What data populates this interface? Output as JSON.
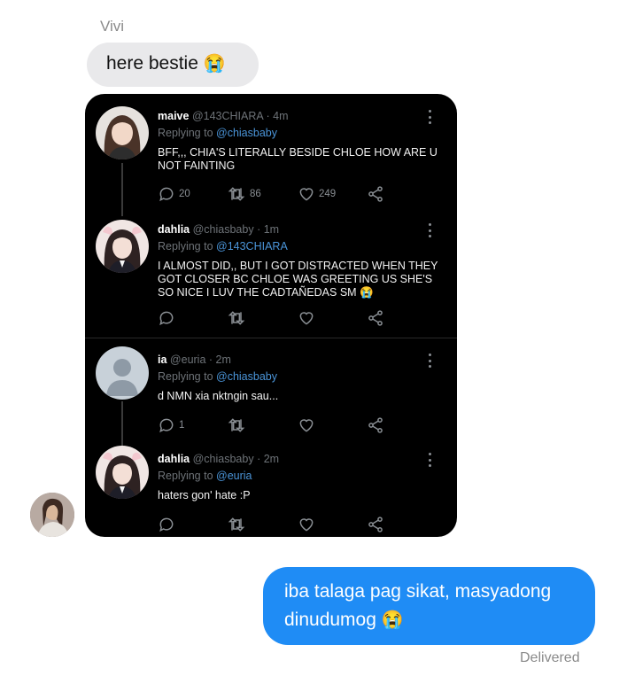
{
  "chat": {
    "sender_name": "Vivi",
    "incoming_message": "here bestie",
    "incoming_emoji": "😭",
    "outgoing_message_line1": "iba talaga pag sikat, masyadong",
    "outgoing_message_line2": "dinudumog",
    "outgoing_emoji": "😭",
    "status": "Delivered"
  },
  "tweets": [
    {
      "name": "maive",
      "handle": "@143CHIARA",
      "time": "· 4m",
      "replying_prefix": "Replying to ",
      "replying_to": "@chiasbaby",
      "body": "BFF,,, CHIA'S LITERALLY BESIDE CHLOE HOW ARE U NOT FAINTING",
      "replies": "20",
      "retweets": "86",
      "likes": "249"
    },
    {
      "name": "dahlia",
      "handle": "@chiasbaby",
      "time": "· 1m",
      "replying_prefix": "Replying to ",
      "replying_to": "@143CHIARA",
      "body": "I ALMOST DID,, BUT I GOT DISTRACTED WHEN THEY GOT CLOSER BC CHLOE WAS GREETING US SHE'S SO NICE I LUV THE CADTAÑEDAS SM 😭",
      "replies": "",
      "retweets": "",
      "likes": ""
    },
    {
      "name": "ia",
      "handle": "@euria",
      "time": "· 2m",
      "replying_prefix": "Replying to ",
      "replying_to": "@chiasbaby",
      "body": "d NMN xia nktngin sau...",
      "replies": "1",
      "retweets": "",
      "likes": ""
    },
    {
      "name": "dahlia",
      "handle": "@chiasbaby",
      "time": "· 2m",
      "replying_prefix": "Replying to ",
      "replying_to": "@euria",
      "body": "haters gon' hate :P",
      "replies": "",
      "retweets": "",
      "likes": ""
    }
  ],
  "icons": {
    "reply": "reply-icon",
    "retweet": "retweet-icon",
    "like": "heart-icon",
    "share": "share-icon",
    "more": "more-vertical-icon"
  },
  "colors": {
    "outgoing_bubble": "#1f8cf5",
    "incoming_bubble": "#e9e9eb",
    "mention": "#4a94d8",
    "card_bg": "#000000"
  }
}
